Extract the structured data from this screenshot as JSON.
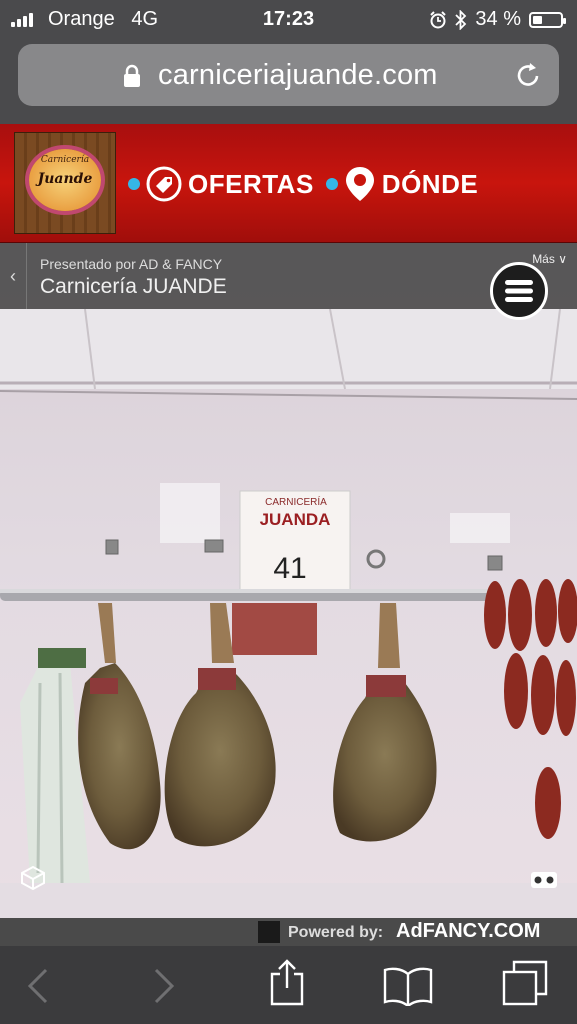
{
  "status": {
    "carrier": "Orange",
    "network": "4G",
    "time": "17:23",
    "battery_text": "34 %",
    "battery_level": 0.34
  },
  "address_bar": {
    "url": "carniceriajuande.com"
  },
  "site_header": {
    "logo_line1": "Carnicería",
    "logo_line2": "Juande",
    "nav": [
      {
        "label": "OFERTAS",
        "icon": "tag-icon"
      },
      {
        "label": "DÓNDE",
        "icon": "location-pin-icon"
      }
    ],
    "accent_color": "#c8150d",
    "dot_color": "#35b6e6"
  },
  "viewer": {
    "presented_prefix": "Presentado por ",
    "presented_by": "AD & FANCY",
    "title": "Carnicería JUANDE",
    "more_label": "Más",
    "price_sign": "41",
    "sign_text": "JUANDA",
    "powered_by": "Powered by:",
    "powered_brand": "AdFANCY.COM"
  },
  "toolbar": {
    "icons": [
      "back-icon",
      "forward-icon",
      "share-icon",
      "bookmarks-icon",
      "tabs-icon"
    ]
  }
}
